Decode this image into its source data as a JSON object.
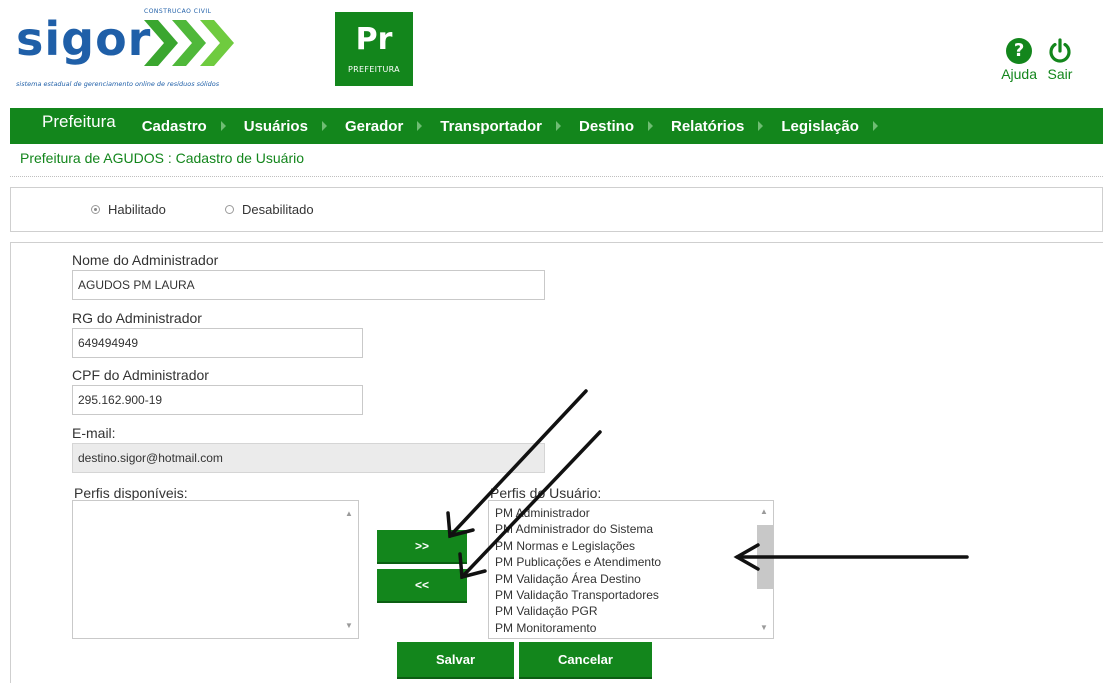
{
  "header": {
    "logo_text": "sigor",
    "logo_small": "CONSTRUCAO CIVIL",
    "logo_tagline": "sistema estadual de gerenciamento online de resíduos sólidos",
    "badge_big": "Pr",
    "badge_small": "PREFEITURA",
    "help_label": "Ajuda",
    "logout_label": "Sair",
    "help_glyph": "?",
    "brand_color": "#13861c",
    "logo_color": "#1f5fa8"
  },
  "nav": {
    "home": "Prefeitura",
    "items": [
      "Cadastro",
      "Usuários",
      "Gerador",
      "Transportador",
      "Destino",
      "Relatórios",
      "Legislação"
    ]
  },
  "breadcrumb": "Prefeitura de AGUDOS : Cadastro de Usuário",
  "status": {
    "enabled_label": "Habilitado",
    "disabled_label": "Desabilitado",
    "selected": "Habilitado"
  },
  "form": {
    "name_label": "Nome do Administrador",
    "name_value": "AGUDOS PM LAURA",
    "rg_label": "RG do Administrador",
    "rg_value": "649494949",
    "cpf_label": "CPF do Administrador",
    "cpf_value": "295.162.900-19",
    "email_label": "E-mail:",
    "email_value": "destino.sigor@hotmail.com",
    "available_label": "Perfis disponíveis:",
    "available_items": [],
    "user_profiles_label": "Perfis do Usuário:",
    "user_profiles": [
      "PM Administrador",
      "PM Administrador do Sistema",
      "PM Normas e Legislações",
      "PM Publicações e Atendimento",
      "PM Validação Área Destino",
      "PM Validação Transportadores",
      "PM Validação PGR",
      "PM Monitoramento"
    ],
    "add_button": ">>",
    "remove_button": "<<",
    "save_button": "Salvar",
    "cancel_button": "Cancelar"
  }
}
